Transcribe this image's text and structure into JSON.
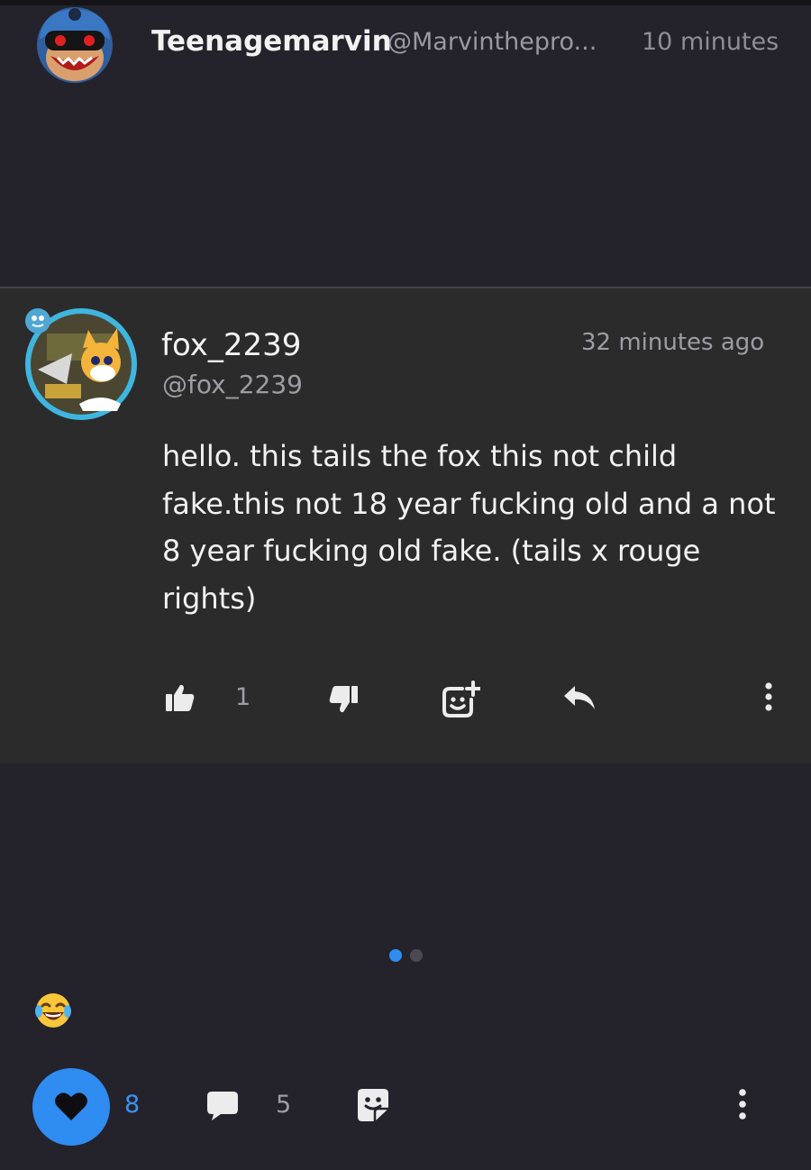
{
  "top_post": {
    "author_name": "Teenagemarvin",
    "author_handle": "@Marvinthepro...",
    "time": "10 minutes"
  },
  "comment_card": {
    "author_name": "fox_2239",
    "author_handle": "@fox_2239",
    "time": "32 minutes ago",
    "body": "hello. this tails the fox this not child fake.this not 18 year fucking old and a not 8 year fucking old fake. (tails x rouge rights)",
    "like_count": "1",
    "actions": {
      "like_icon": "thumbs-up-icon",
      "dislike_icon": "thumbs-down-icon",
      "sticker_icon": "add-sticker-icon",
      "reply_icon": "reply-icon",
      "more_icon": "more-vertical-icon"
    }
  },
  "pagination": {
    "current": 1,
    "total": 2
  },
  "reaction_emoji_icon": "tears-of-joy-emoji",
  "bottom_bar": {
    "like_count": "8",
    "comment_count": "5",
    "like_icon": "heart-icon",
    "comment_icon": "comment-bubble-icon",
    "share_icon": "sticker-share-icon",
    "more_icon": "more-vertical-icon"
  },
  "colors": {
    "background": "#24222b",
    "card_background": "#2c2b2c",
    "accent_blue": "#2f8cf0",
    "muted_text": "#9e9da3"
  }
}
